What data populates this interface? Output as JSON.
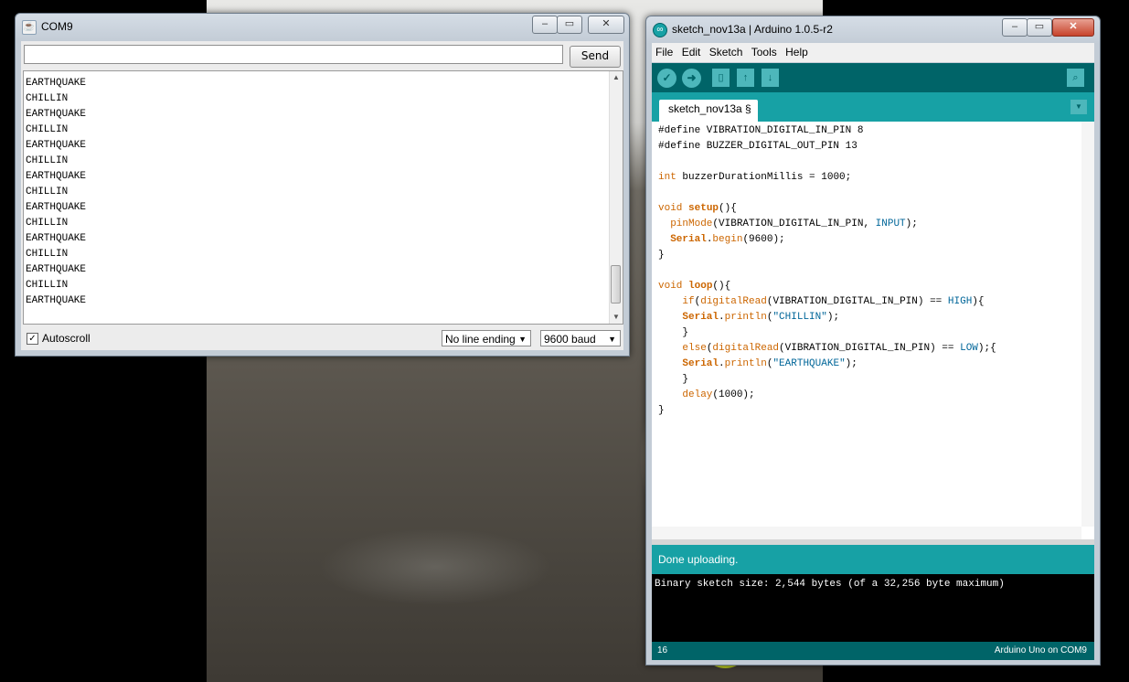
{
  "colors": {
    "arduino_dark": "#006468",
    "arduino_teal": "#17a1a5",
    "keyword": "#cc6600",
    "constant": "#006699"
  },
  "serial_monitor": {
    "title": "COM9",
    "send_label": "Send",
    "input_value": "",
    "output_lines": [
      "EARTHQUAKE",
      "CHILLIN",
      "EARTHQUAKE",
      "CHILLIN",
      "EARTHQUAKE",
      "CHILLIN",
      "EARTHQUAKE",
      "CHILLIN",
      "EARTHQUAKE",
      "CHILLIN",
      "EARTHQUAKE",
      "CHILLIN",
      "EARTHQUAKE",
      "CHILLIN",
      "EARTHQUAKE"
    ],
    "autoscroll_label": "Autoscroll",
    "autoscroll_checked": true,
    "line_ending": "No line ending",
    "baud": "9600 baud"
  },
  "ide": {
    "title": "sketch_nov13a | Arduino 1.0.5-r2",
    "menu": [
      "File",
      "Edit",
      "Sketch",
      "Tools",
      "Help"
    ],
    "tab_label": "sketch_nov13a §",
    "code_lines": [
      "#define VIBRATION_DIGITAL_IN_PIN 8",
      "#define BUZZER_DIGITAL_OUT_PIN 13",
      "",
      "int buzzerDurationMillis = 1000;",
      "",
      "void setup(){",
      "  pinMode(VIBRATION_DIGITAL_IN_PIN, INPUT);",
      "  Serial.begin(9600);",
      "}",
      "",
      "void loop(){",
      "    if(digitalRead(VIBRATION_DIGITAL_IN_PIN) == HIGH){",
      "    Serial.println(\"CHILLIN\");",
      "    }",
      "    else(digitalRead(VIBRATION_DIGITAL_IN_PIN) == LOW);{",
      "    Serial.println(\"EARTHQUAKE\");",
      "    }",
      "    delay(1000);",
      "}"
    ],
    "status": "Done uploading.",
    "console": "Binary sketch size: 2,544 bytes (of a 32,256 byte maximum)",
    "line_number": "16",
    "board": "Arduino Uno on COM9"
  }
}
